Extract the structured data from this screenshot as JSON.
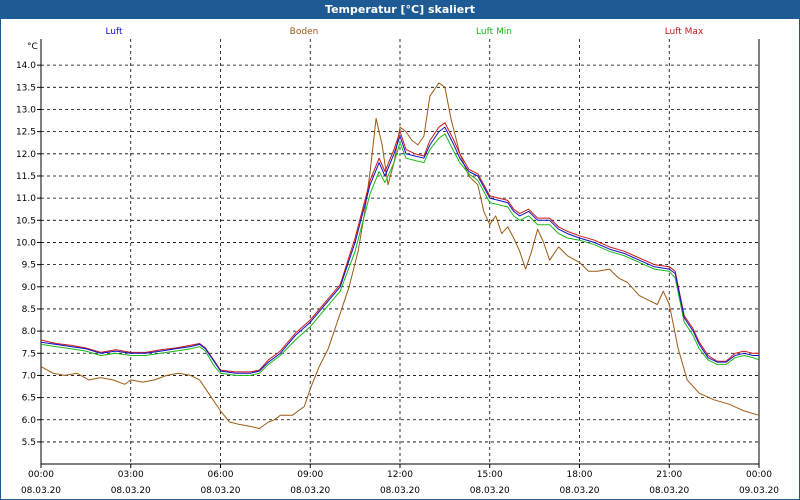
{
  "window_title": "Temperatur [°C] skaliert",
  "chart_data": {
    "type": "line",
    "title": "Temperatur [°C] skaliert",
    "ylabel": "°C",
    "xlabel": "",
    "ylim": [
      5.25,
      14.5
    ],
    "xlim_hours": [
      0,
      24
    ],
    "grid": true,
    "legend_placement": "top",
    "x_ticks": [
      {
        "time": "00:00",
        "date": "08.03.20"
      },
      {
        "time": "03:00",
        "date": "08.03.20"
      },
      {
        "time": "06:00",
        "date": "08.03.20"
      },
      {
        "time": "09:00",
        "date": "08.03.20"
      },
      {
        "time": "12:00",
        "date": "08.03.20"
      },
      {
        "time": "15:00",
        "date": "08.03.20"
      },
      {
        "time": "18:00",
        "date": "08.03.20"
      },
      {
        "time": "21:00",
        "date": "08.03.20"
      },
      {
        "time": "00:00",
        "date": "09.03.20"
      }
    ],
    "y_ticks": [
      "5.5",
      "6.0",
      "6.5",
      "7.0",
      "7.5",
      "8.0",
      "8.5",
      "9.0",
      "9.5",
      "10.0",
      "10.5",
      "11.0",
      "11.5",
      "12.0",
      "12.5",
      "13.0",
      "13.5",
      "14.0"
    ],
    "series": [
      {
        "name": "Luft",
        "color": "#1010c8",
        "points": [
          [
            0,
            7.75
          ],
          [
            0.5,
            7.7
          ],
          [
            1,
            7.65
          ],
          [
            1.5,
            7.6
          ],
          [
            2,
            7.5
          ],
          [
            2.5,
            7.55
          ],
          [
            3,
            7.5
          ],
          [
            3.5,
            7.5
          ],
          [
            4,
            7.55
          ],
          [
            4.5,
            7.6
          ],
          [
            5,
            7.65
          ],
          [
            5.3,
            7.7
          ],
          [
            5.5,
            7.6
          ],
          [
            5.8,
            7.3
          ],
          [
            6,
            7.1
          ],
          [
            6.5,
            7.05
          ],
          [
            7,
            7.05
          ],
          [
            7.3,
            7.1
          ],
          [
            7.6,
            7.3
          ],
          [
            8,
            7.5
          ],
          [
            8.5,
            7.9
          ],
          [
            9,
            8.2
          ],
          [
            9.5,
            8.6
          ],
          [
            10,
            9.0
          ],
          [
            10.5,
            10.0
          ],
          [
            11,
            11.3
          ],
          [
            11.3,
            11.8
          ],
          [
            11.5,
            11.5
          ],
          [
            11.8,
            12.0
          ],
          [
            12,
            12.4
          ],
          [
            12.2,
            12.0
          ],
          [
            12.5,
            11.95
          ],
          [
            12.8,
            11.9
          ],
          [
            13,
            12.2
          ],
          [
            13.3,
            12.5
          ],
          [
            13.5,
            12.6
          ],
          [
            13.8,
            12.2
          ],
          [
            14,
            11.9
          ],
          [
            14.3,
            11.6
          ],
          [
            14.6,
            11.5
          ],
          [
            15,
            11.0
          ],
          [
            15.3,
            10.95
          ],
          [
            15.6,
            10.9
          ],
          [
            15.8,
            10.7
          ],
          [
            16,
            10.6
          ],
          [
            16.3,
            10.7
          ],
          [
            16.6,
            10.5
          ],
          [
            17,
            10.5
          ],
          [
            17.3,
            10.3
          ],
          [
            17.6,
            10.2
          ],
          [
            18,
            10.1
          ],
          [
            18.5,
            10.0
          ],
          [
            19,
            9.85
          ],
          [
            19.5,
            9.75
          ],
          [
            20,
            9.6
          ],
          [
            20.5,
            9.45
          ],
          [
            21,
            9.4
          ],
          [
            21.2,
            9.3
          ],
          [
            21.5,
            8.3
          ],
          [
            21.8,
            8.0
          ],
          [
            22,
            7.7
          ],
          [
            22.3,
            7.4
          ],
          [
            22.6,
            7.3
          ],
          [
            22.9,
            7.3
          ],
          [
            23.2,
            7.45
          ],
          [
            23.5,
            7.5
          ],
          [
            23.8,
            7.45
          ],
          [
            24,
            7.45
          ]
        ]
      },
      {
        "name": "Boden",
        "color": "#9c5a14",
        "points": [
          [
            0,
            7.2
          ],
          [
            0.4,
            7.05
          ],
          [
            0.8,
            7.0
          ],
          [
            1.2,
            7.05
          ],
          [
            1.6,
            6.9
          ],
          [
            2,
            6.95
          ],
          [
            2.4,
            6.9
          ],
          [
            2.8,
            6.8
          ],
          [
            3,
            6.9
          ],
          [
            3.4,
            6.85
          ],
          [
            3.8,
            6.9
          ],
          [
            4.2,
            7.0
          ],
          [
            4.6,
            7.05
          ],
          [
            5,
            7.0
          ],
          [
            5.3,
            6.9
          ],
          [
            5.6,
            6.6
          ],
          [
            5.8,
            6.4
          ],
          [
            6,
            6.2
          ],
          [
            6.3,
            5.95
          ],
          [
            6.6,
            5.9
          ],
          [
            7,
            5.85
          ],
          [
            7.3,
            5.8
          ],
          [
            7.6,
            5.95
          ],
          [
            7.8,
            6.0
          ],
          [
            8,
            6.1
          ],
          [
            8.4,
            6.1
          ],
          [
            8.8,
            6.3
          ],
          [
            9,
            6.7
          ],
          [
            9.3,
            7.2
          ],
          [
            9.6,
            7.6
          ],
          [
            10,
            8.4
          ],
          [
            10.3,
            9.0
          ],
          [
            10.6,
            9.8
          ],
          [
            10.8,
            10.6
          ],
          [
            11,
            11.6
          ],
          [
            11.2,
            12.8
          ],
          [
            11.4,
            12.2
          ],
          [
            11.6,
            11.3
          ],
          [
            11.8,
            11.8
          ],
          [
            12,
            12.6
          ],
          [
            12.2,
            12.5
          ],
          [
            12.4,
            12.3
          ],
          [
            12.6,
            12.2
          ],
          [
            12.8,
            12.4
          ],
          [
            13,
            13.3
          ],
          [
            13.3,
            13.6
          ],
          [
            13.5,
            13.5
          ],
          [
            13.7,
            12.8
          ],
          [
            14,
            12.0
          ],
          [
            14.3,
            11.5
          ],
          [
            14.6,
            11.3
          ],
          [
            14.8,
            10.7
          ],
          [
            15,
            10.4
          ],
          [
            15.2,
            10.6
          ],
          [
            15.4,
            10.2
          ],
          [
            15.6,
            10.35
          ],
          [
            15.8,
            10.1
          ],
          [
            16,
            9.8
          ],
          [
            16.2,
            9.4
          ],
          [
            16.4,
            9.8
          ],
          [
            16.6,
            10.3
          ],
          [
            16.8,
            10.0
          ],
          [
            17,
            9.6
          ],
          [
            17.3,
            9.9
          ],
          [
            17.6,
            9.7
          ],
          [
            18,
            9.55
          ],
          [
            18.3,
            9.35
          ],
          [
            18.6,
            9.35
          ],
          [
            19,
            9.4
          ],
          [
            19.3,
            9.2
          ],
          [
            19.6,
            9.1
          ],
          [
            20,
            8.8
          ],
          [
            20.3,
            8.7
          ],
          [
            20.6,
            8.6
          ],
          [
            20.8,
            8.9
          ],
          [
            21,
            8.6
          ],
          [
            21.3,
            7.6
          ],
          [
            21.6,
            6.9
          ],
          [
            22,
            6.6
          ],
          [
            22.5,
            6.45
          ],
          [
            23,
            6.35
          ],
          [
            23.5,
            6.2
          ],
          [
            24,
            6.1
          ]
        ]
      },
      {
        "name": "Luft Min",
        "color": "#18b818",
        "points": [
          [
            0,
            7.7
          ],
          [
            0.5,
            7.65
          ],
          [
            1,
            7.6
          ],
          [
            1.5,
            7.55
          ],
          [
            2,
            7.45
          ],
          [
            2.5,
            7.5
          ],
          [
            3,
            7.45
          ],
          [
            3.5,
            7.45
          ],
          [
            4,
            7.5
          ],
          [
            4.5,
            7.55
          ],
          [
            5,
            7.6
          ],
          [
            5.3,
            7.65
          ],
          [
            5.5,
            7.55
          ],
          [
            5.8,
            7.2
          ],
          [
            6,
            7.05
          ],
          [
            6.5,
            7.0
          ],
          [
            7,
            7.0
          ],
          [
            7.3,
            7.05
          ],
          [
            7.6,
            7.25
          ],
          [
            8,
            7.45
          ],
          [
            8.5,
            7.8
          ],
          [
            9,
            8.1
          ],
          [
            9.5,
            8.5
          ],
          [
            10,
            8.9
          ],
          [
            10.5,
            9.8
          ],
          [
            11,
            11.1
          ],
          [
            11.3,
            11.6
          ],
          [
            11.5,
            11.35
          ],
          [
            11.8,
            11.8
          ],
          [
            12,
            12.25
          ],
          [
            12.2,
            11.9
          ],
          [
            12.5,
            11.85
          ],
          [
            12.8,
            11.8
          ],
          [
            13,
            12.1
          ],
          [
            13.3,
            12.35
          ],
          [
            13.5,
            12.45
          ],
          [
            13.8,
            12.05
          ],
          [
            14,
            11.8
          ],
          [
            14.3,
            11.55
          ],
          [
            14.6,
            11.4
          ],
          [
            15,
            10.9
          ],
          [
            15.3,
            10.85
          ],
          [
            15.6,
            10.8
          ],
          [
            15.8,
            10.6
          ],
          [
            16,
            10.5
          ],
          [
            16.3,
            10.6
          ],
          [
            16.6,
            10.4
          ],
          [
            17,
            10.4
          ],
          [
            17.3,
            10.2
          ],
          [
            17.6,
            10.1
          ],
          [
            18,
            10.05
          ],
          [
            18.5,
            9.95
          ],
          [
            19,
            9.8
          ],
          [
            19.5,
            9.7
          ],
          [
            20,
            9.55
          ],
          [
            20.5,
            9.4
          ],
          [
            21,
            9.35
          ],
          [
            21.2,
            9.2
          ],
          [
            21.5,
            8.2
          ],
          [
            21.8,
            7.9
          ],
          [
            22,
            7.6
          ],
          [
            22.3,
            7.35
          ],
          [
            22.6,
            7.25
          ],
          [
            22.9,
            7.25
          ],
          [
            23.2,
            7.4
          ],
          [
            23.5,
            7.45
          ],
          [
            23.8,
            7.4
          ],
          [
            24,
            7.35
          ]
        ]
      },
      {
        "name": "Luft Max",
        "color": "#c81818",
        "points": [
          [
            0,
            7.8
          ],
          [
            0.5,
            7.72
          ],
          [
            1,
            7.68
          ],
          [
            1.5,
            7.62
          ],
          [
            2,
            7.52
          ],
          [
            2.5,
            7.58
          ],
          [
            3,
            7.52
          ],
          [
            3.5,
            7.52
          ],
          [
            4,
            7.58
          ],
          [
            4.5,
            7.62
          ],
          [
            5,
            7.68
          ],
          [
            5.3,
            7.72
          ],
          [
            5.5,
            7.62
          ],
          [
            5.8,
            7.32
          ],
          [
            6,
            7.12
          ],
          [
            6.5,
            7.08
          ],
          [
            7,
            7.08
          ],
          [
            7.3,
            7.12
          ],
          [
            7.6,
            7.35
          ],
          [
            8,
            7.55
          ],
          [
            8.5,
            7.95
          ],
          [
            9,
            8.25
          ],
          [
            9.5,
            8.65
          ],
          [
            10,
            9.05
          ],
          [
            10.5,
            10.1
          ],
          [
            11,
            11.4
          ],
          [
            11.3,
            11.9
          ],
          [
            11.5,
            11.6
          ],
          [
            11.8,
            12.1
          ],
          [
            12,
            12.5
          ],
          [
            12.2,
            12.1
          ],
          [
            12.5,
            12.0
          ],
          [
            12.8,
            11.95
          ],
          [
            13,
            12.3
          ],
          [
            13.3,
            12.6
          ],
          [
            13.5,
            12.7
          ],
          [
            13.8,
            12.3
          ],
          [
            14,
            12.0
          ],
          [
            14.3,
            11.65
          ],
          [
            14.6,
            11.55
          ],
          [
            15,
            11.05
          ],
          [
            15.3,
            11.0
          ],
          [
            15.6,
            10.95
          ],
          [
            15.8,
            10.75
          ],
          [
            16,
            10.65
          ],
          [
            16.3,
            10.75
          ],
          [
            16.6,
            10.55
          ],
          [
            17,
            10.55
          ],
          [
            17.3,
            10.35
          ],
          [
            17.6,
            10.25
          ],
          [
            18,
            10.15
          ],
          [
            18.5,
            10.05
          ],
          [
            19,
            9.9
          ],
          [
            19.5,
            9.8
          ],
          [
            20,
            9.65
          ],
          [
            20.5,
            9.5
          ],
          [
            21,
            9.45
          ],
          [
            21.2,
            9.35
          ],
          [
            21.5,
            8.35
          ],
          [
            21.8,
            8.05
          ],
          [
            22,
            7.75
          ],
          [
            22.3,
            7.45
          ],
          [
            22.6,
            7.32
          ],
          [
            22.9,
            7.32
          ],
          [
            23.2,
            7.5
          ],
          [
            23.5,
            7.55
          ],
          [
            23.8,
            7.5
          ],
          [
            24,
            7.5
          ]
        ]
      }
    ]
  }
}
